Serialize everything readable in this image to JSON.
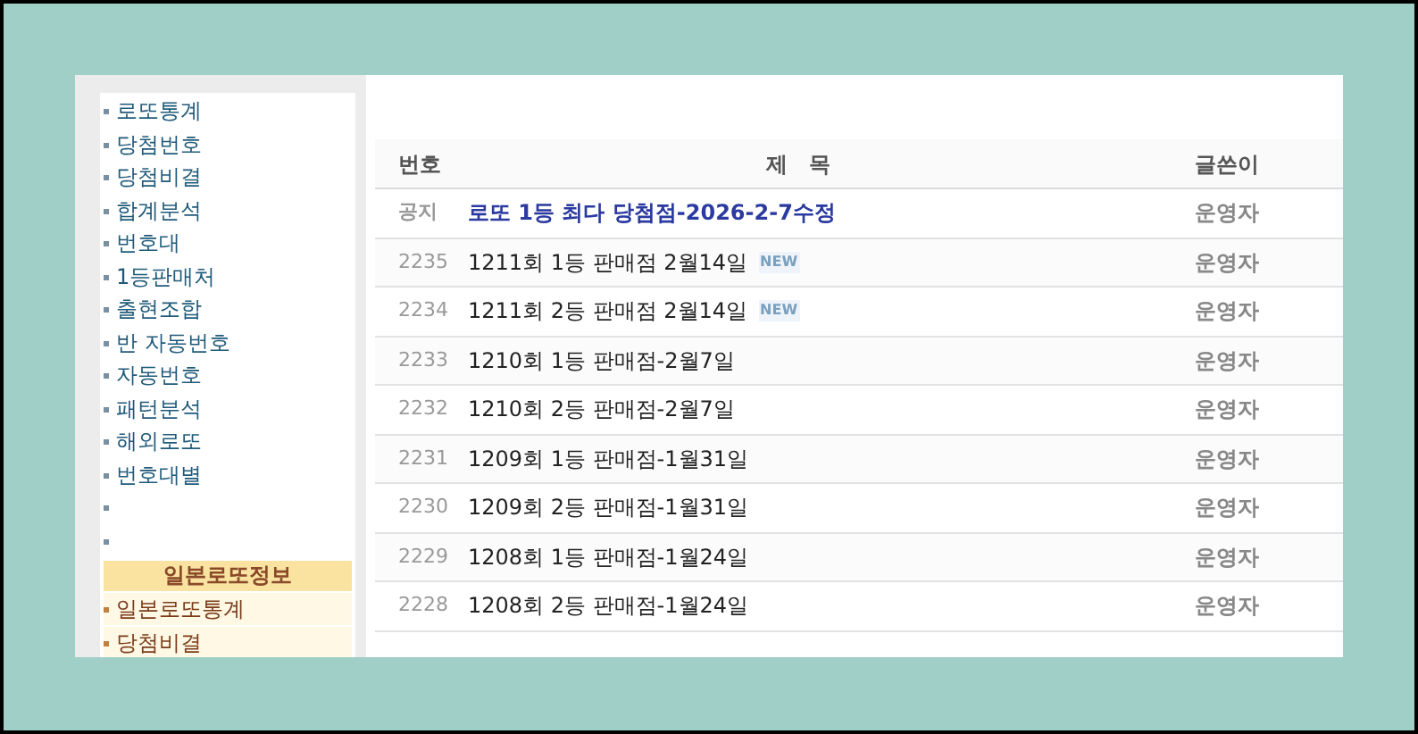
{
  "sidebar": {
    "items": [
      {
        "kind": "link",
        "label": "로또통계"
      },
      {
        "kind": "link",
        "label": "당첨번호"
      },
      {
        "kind": "link",
        "label": "당첨비결"
      },
      {
        "kind": "link",
        "label": "합계분석"
      },
      {
        "kind": "link",
        "label": "번호대"
      },
      {
        "kind": "link",
        "label": "1등판매처"
      },
      {
        "kind": "link",
        "label": "출현조합"
      },
      {
        "kind": "link",
        "label": "반 자동번호"
      },
      {
        "kind": "link",
        "label": "자동번호"
      },
      {
        "kind": "link",
        "label": "패턴분석"
      },
      {
        "kind": "link",
        "label": "해외로또"
      },
      {
        "kind": "link",
        "label": "번호대별"
      },
      {
        "kind": "spacer"
      },
      {
        "kind": "spacer"
      }
    ],
    "section": {
      "title": "일본로또정보",
      "items": [
        {
          "label": "일본로또통계"
        },
        {
          "label": "당첨비결"
        }
      ]
    }
  },
  "table": {
    "columns": [
      "번호",
      "제　목",
      "글쓴이"
    ],
    "rows": [
      {
        "kind": "notice",
        "number": "공지",
        "title": "로또 1등 최다 당첨점-2026-2-7수정",
        "author": "운영자"
      },
      {
        "kind": "post",
        "number": "2235",
        "title": "1211회 1등 판매점 2월14일",
        "author": "운영자",
        "badge": "NEW"
      },
      {
        "kind": "post",
        "number": "2234",
        "title": "1211회 2등 판매점 2월14일",
        "author": "운영자",
        "badge": "NEW"
      },
      {
        "kind": "post",
        "number": "2233",
        "title": "1210회 1등 판매점-2월7일",
        "author": "운영자"
      },
      {
        "kind": "post",
        "number": "2232",
        "title": "1210회 2등 판매점-2월7일",
        "author": "운영자"
      },
      {
        "kind": "post",
        "number": "2231",
        "title": "1209회 1등 판매점-1월31일",
        "author": "운영자"
      },
      {
        "kind": "post",
        "number": "2230",
        "title": "1209회 2등 판매점-1월31일",
        "author": "운영자"
      },
      {
        "kind": "post",
        "number": "2229",
        "title": "1208회 1등 판매점-1월24일",
        "author": "운영자"
      },
      {
        "kind": "post",
        "number": "2228",
        "title": "1208회 2등 판매점-1월24일",
        "author": "운영자"
      }
    ]
  }
}
